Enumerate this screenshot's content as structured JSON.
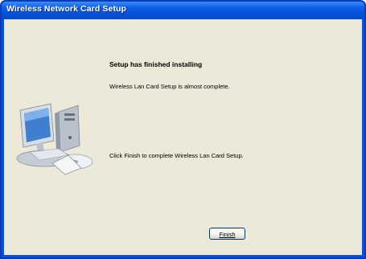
{
  "window": {
    "title": "Wireless Network Card Setup"
  },
  "content": {
    "heading": "Setup has finished installing",
    "line1": "Wireless Lan Card Setup is almost complete.",
    "line2": "Click Finish to complete Wireless Lan Card Setup."
  },
  "buttons": {
    "finish_label": "Finish"
  },
  "icons": {
    "illustration": "computer-with-disk-icon"
  },
  "colors": {
    "titlebar": "#0b5ee8",
    "client_bg": "#ece9d8",
    "border": "#0a3cb8"
  }
}
